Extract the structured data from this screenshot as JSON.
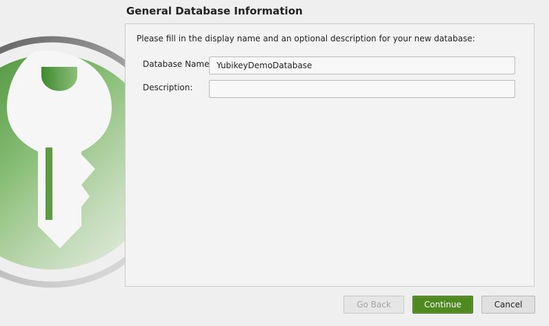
{
  "header": {
    "title": "General Database Information"
  },
  "form": {
    "intro": "Please fill in the display name and an optional description for your new database:",
    "name_label": "Database Name:",
    "name_value": "YubikeyDemoDatabase",
    "description_label": "Description:",
    "description_value": ""
  },
  "buttons": {
    "back": "Go Back",
    "continue": "Continue",
    "cancel": "Cancel"
  },
  "colors": {
    "accent": "#4f8a21",
    "logo_green": "#5a9a3a"
  },
  "icons": {
    "logo": "keepassxc-key-logo"
  }
}
